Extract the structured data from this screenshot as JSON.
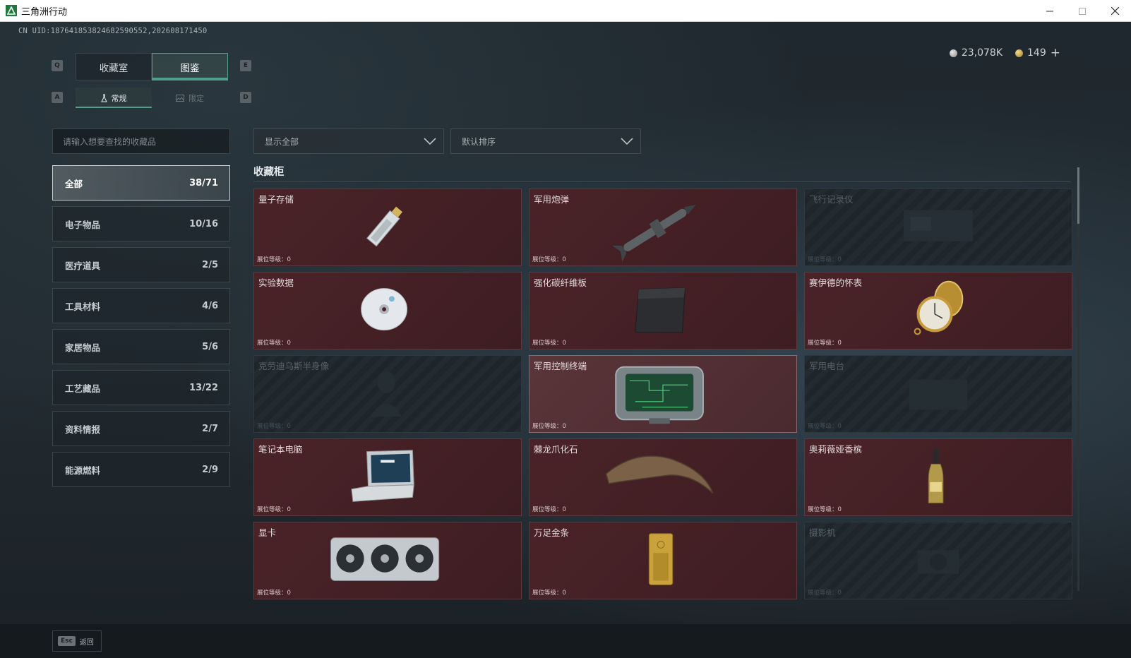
{
  "window": {
    "title": "三角洲行动"
  },
  "uid": "CN UID:187641853824682590552,202608171450",
  "currency": {
    "silver": "23,078K",
    "gold": "149",
    "plus": "+"
  },
  "keys": {
    "q": "Q",
    "e": "E",
    "a": "A",
    "d": "D"
  },
  "main_tabs": [
    {
      "label": "收藏室",
      "active": false
    },
    {
      "label": "图鉴",
      "active": true
    }
  ],
  "sub_tabs": [
    {
      "label": "常规",
      "active": true
    },
    {
      "label": "限定",
      "active": false
    }
  ],
  "search": {
    "placeholder": "请输入想要查找的收藏品"
  },
  "filters": {
    "display": "显示全部",
    "sort": "默认排序"
  },
  "categories": [
    {
      "label": "全部",
      "count": "38/71",
      "active": true
    },
    {
      "label": "电子物品",
      "count": "10/16",
      "active": false
    },
    {
      "label": "医疗道具",
      "count": "2/5",
      "active": false
    },
    {
      "label": "工具材料",
      "count": "4/6",
      "active": false
    },
    {
      "label": "家居物品",
      "count": "5/6",
      "active": false
    },
    {
      "label": "工艺藏品",
      "count": "13/22",
      "active": false
    },
    {
      "label": "资料情报",
      "count": "2/7",
      "active": false
    },
    {
      "label": "能源燃料",
      "count": "2/9",
      "active": false
    }
  ],
  "section": {
    "title": "收藏柜"
  },
  "level_label": "展位等级：",
  "items": [
    {
      "name": "量子存储",
      "level": "0",
      "locked": false,
      "icon": "usb-drive"
    },
    {
      "name": "军用炮弹",
      "level": "0",
      "locked": false,
      "icon": "missile"
    },
    {
      "name": "飞行记录仪",
      "level": "0",
      "locked": true,
      "icon": "flight-recorder"
    },
    {
      "name": "实验数据",
      "level": "0",
      "locked": false,
      "icon": "disc"
    },
    {
      "name": "强化碳纤维板",
      "level": "0",
      "locked": false,
      "icon": "carbon-plate"
    },
    {
      "name": "赛伊德的怀表",
      "level": "0",
      "locked": false,
      "icon": "pocket-watch"
    },
    {
      "name": "克劳迪乌斯半身像",
      "level": "0",
      "locked": true,
      "icon": "bust"
    },
    {
      "name": "军用控制终端",
      "level": "0",
      "locked": false,
      "highlight": true,
      "icon": "control-terminal"
    },
    {
      "name": "军用电台",
      "level": "0",
      "locked": true,
      "icon": "radio"
    },
    {
      "name": "笔记本电脑",
      "level": "0",
      "locked": false,
      "icon": "laptop"
    },
    {
      "name": "棘龙爪化石",
      "level": "0",
      "locked": false,
      "icon": "claw-fossil"
    },
    {
      "name": "奥莉薇娅香槟",
      "level": "0",
      "locked": false,
      "icon": "champagne"
    },
    {
      "name": "显卡",
      "level": "0",
      "locked": false,
      "icon": "graphics-card"
    },
    {
      "name": "万足金条",
      "level": "0",
      "locked": false,
      "icon": "gold-bar"
    },
    {
      "name": "摄影机",
      "level": "0",
      "locked": true,
      "icon": "camera"
    }
  ],
  "footer": {
    "esc_key": "Esc",
    "back_label": "返回"
  },
  "colors": {
    "accent": "#4f9f8a",
    "card_owned": "#4a2328",
    "card_locked": "#1e262b"
  }
}
